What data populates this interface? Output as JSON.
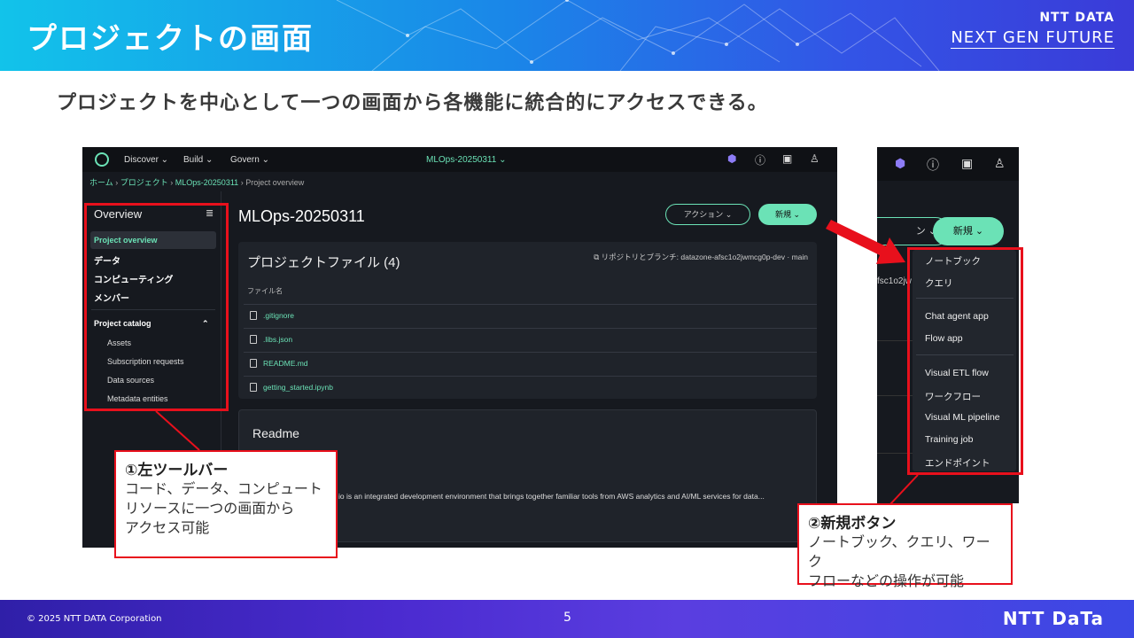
{
  "header": {
    "title": "プロジェクトの画面",
    "brand_line1": "NTT DATA",
    "brand_line2": "NEXT GEN FUTURE"
  },
  "subtitle": "プロジェクトを中心として一つの画面から各機能に統合的にアクセスできる。",
  "shot1": {
    "topnav": {
      "menus": [
        "Discover ⌄",
        "Build ⌄",
        "Govern ⌄"
      ],
      "project_selector": "MLOps-20250311 ⌄",
      "icons": [
        "q-icon",
        "help-icon",
        "feedback-icon",
        "user-icon"
      ]
    },
    "breadcrumb": [
      "ホーム",
      "プロジェクト",
      "MLOps-20250311",
      "Project overview"
    ],
    "sidebar": {
      "heading": "Overview",
      "items": [
        "Project overview",
        "データ",
        "コンピューティング",
        "メンバー"
      ],
      "catalog_heading": "Project catalog",
      "catalog_items": [
        "Assets",
        "Subscription requests",
        "Data sources",
        "Metadata entities"
      ]
    },
    "main": {
      "project_title": "MLOps-20250311",
      "action_button": "アクション ⌄",
      "new_button": "新規 ⌄",
      "files_title": "プロジェクトファイル (4)",
      "repo_info": "リポジトリとブランチ: datazone-afsc1o2jwmcg0p-dev · main",
      "column_header": "ファイル名",
      "files": [
        ".gitignore",
        ".libs.json",
        "README.md",
        "getting_started.ipynb"
      ],
      "readme_title": "Readme",
      "readme_text": "io is an integrated development environment that brings together familiar tools from AWS analytics and AI/ML services for data..."
    }
  },
  "shot2": {
    "action_button_partial": "ン ⌄",
    "new_button": "新規 ⌄",
    "partial_text": "fsc1o2jw",
    "menu_items": [
      "ノートブック",
      "クエリ",
      "Chat agent app",
      "Flow app",
      "Visual ETL flow",
      "ワークフロー",
      "Visual ML pipeline",
      "Training job",
      "エンドポイント"
    ]
  },
  "callout1": {
    "title": "①左ツールバー",
    "body": [
      "コード、データ、コンピュート",
      "リソースに一つの画面から",
      "アクセス可能"
    ]
  },
  "callout2": {
    "title": "②新規ボタン",
    "body": [
      "ノートブック、クエリ、ワーク",
      "フローなどの操作が可能"
    ]
  },
  "footer": {
    "copyright": "© 2025 NTT DATA Corporation",
    "page": "5",
    "brand": "NTT DaTa"
  },
  "colors": {
    "accent_green": "#6be2b6",
    "highlight_red": "#e8101c"
  }
}
